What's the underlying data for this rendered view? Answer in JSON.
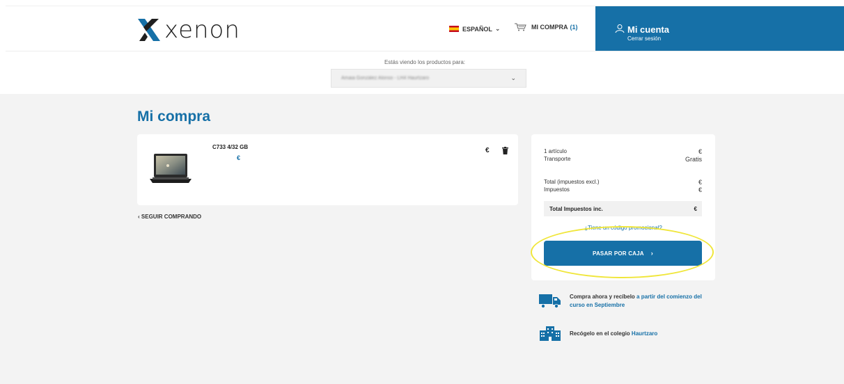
{
  "header": {
    "logo_text": "xenon",
    "language": "ESPAÑOL",
    "cart_label": "MI COMPRA",
    "cart_count": "(1)",
    "account_title": "Mi cuenta",
    "account_sub": "Cerrar sesión"
  },
  "subbar": {
    "viewing_label": "Estás viendo los productos para:",
    "selected_student": "Amaia González Alonso - LH4 Haurtzaro"
  },
  "page": {
    "title": "Mi compra",
    "continue_label": "SEGUIR COMPRANDO"
  },
  "cart_item": {
    "name": "C733 4/32 GB",
    "price": "€",
    "line_total": "€"
  },
  "summary": {
    "articles_label": "1 artículo",
    "articles_value": "€",
    "shipping_label": "Transporte",
    "shipping_value": "Gratis",
    "total_excl_label": "Total (impuestos excl.)",
    "total_excl_value": "€",
    "taxes_label": "Impuestos",
    "taxes_value": "€",
    "total_incl_label": "Total Impuestos inc.",
    "total_incl_value": "€",
    "promo_label": "¿Tiene un código promocional?",
    "checkout_label": "PASAR POR CAJA",
    "checkout_arrow": "›"
  },
  "info": {
    "delivery_text": "Compra ahora y recíbelo ",
    "delivery_highlight": "a partir del comienzo del curso en Septiembre",
    "pickup_text": "Recógelo en el colegio ",
    "pickup_highlight": "Haurtzaro"
  },
  "colors": {
    "brand_blue": "#1670a7",
    "highlight_yellow": "#f0e63a"
  }
}
